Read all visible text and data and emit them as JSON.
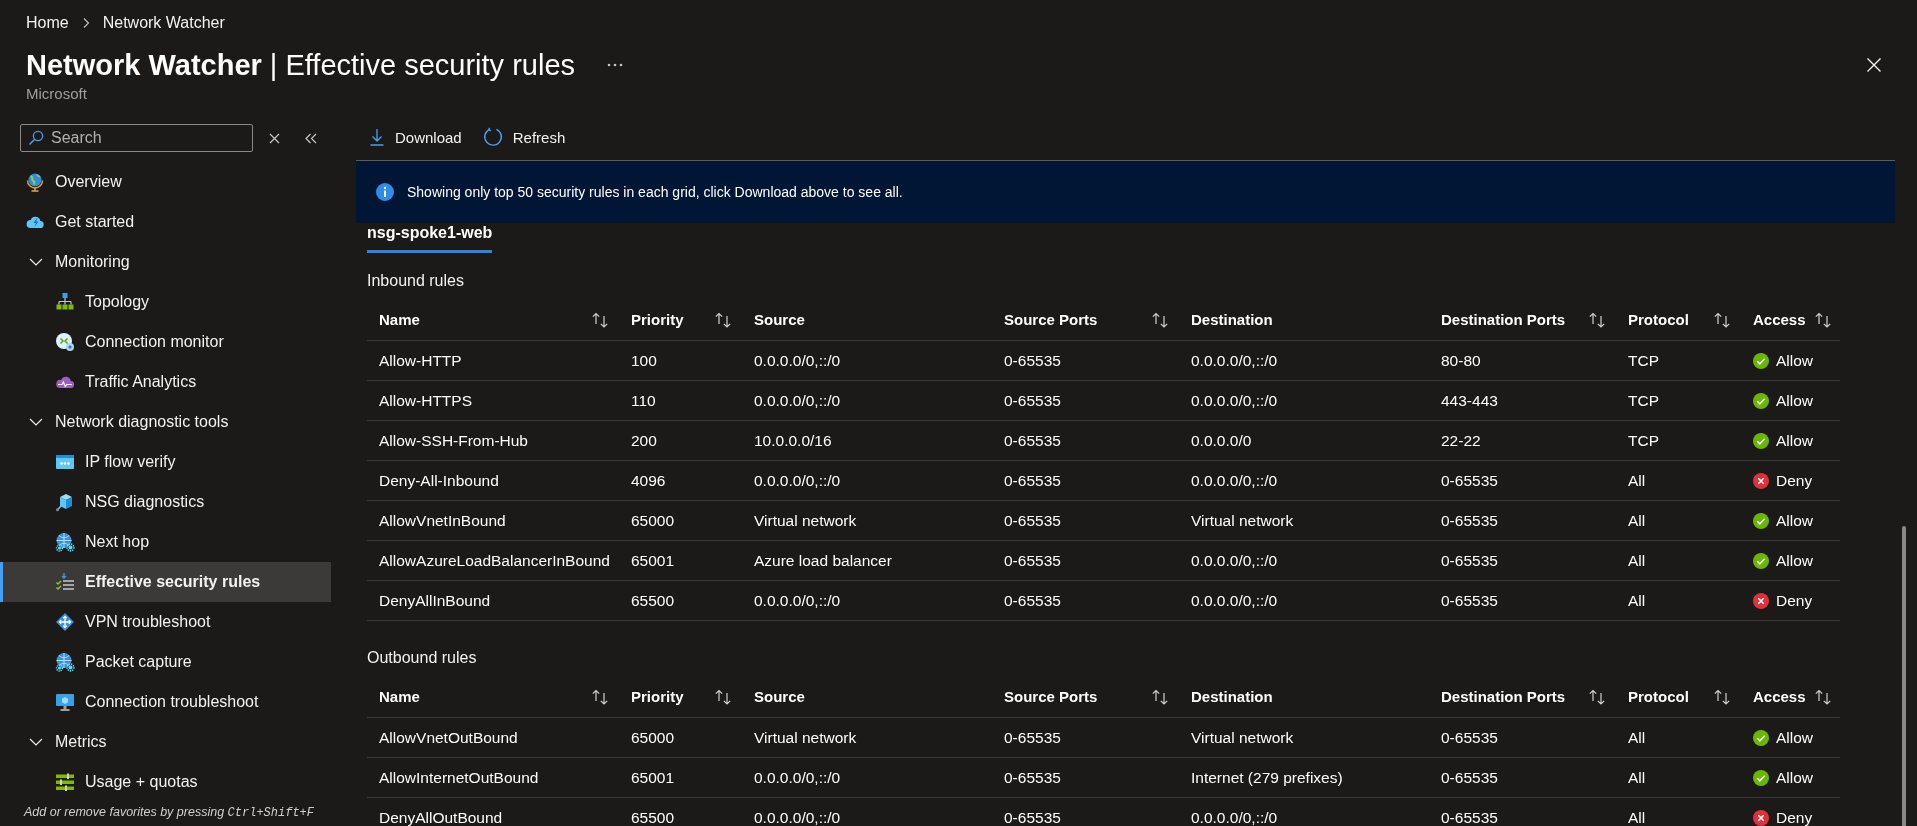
{
  "breadcrumb": [
    {
      "label": "Home"
    },
    {
      "label": "Network Watcher"
    }
  ],
  "header": {
    "title": "**Network Watcher** | Effective security rules",
    "subtitle": "Microsoft"
  },
  "sidebar": {
    "search": {
      "placeholder": "Search"
    },
    "items": [
      {
        "kind": "link",
        "label": "Overview",
        "selected": false
      },
      {
        "kind": "link",
        "label": "Get started",
        "selected": false
      },
      {
        "kind": "group",
        "label": "Monitoring",
        "expanded": true,
        "children": [
          {
            "kind": "link",
            "label": "Topology",
            "selected": false
          },
          {
            "kind": "link",
            "label": "Connection monitor",
            "selected": false
          },
          {
            "kind": "link",
            "label": "Traffic Analytics",
            "selected": false
          }
        ]
      },
      {
        "kind": "group",
        "label": "Network diagnostic tools",
        "expanded": true,
        "children": [
          {
            "kind": "link",
            "label": "IP flow verify",
            "selected": false
          },
          {
            "kind": "link",
            "label": "NSG diagnostics",
            "selected": false
          },
          {
            "kind": "link",
            "label": "Next hop",
            "selected": false
          },
          {
            "kind": "link",
            "label": "Effective security rules",
            "selected": true
          },
          {
            "kind": "link",
            "label": "VPN troubleshoot",
            "selected": false
          },
          {
            "kind": "link",
            "label": "Packet capture",
            "selected": false
          },
          {
            "kind": "link",
            "label": "Connection troubleshoot",
            "selected": false
          }
        ]
      },
      {
        "kind": "group",
        "label": "Metrics",
        "expanded": true,
        "children": [
          {
            "kind": "link",
            "label": "Usage + quotas",
            "selected": false
          }
        ]
      }
    ],
    "favorites_hint": {
      "text": "Add or remove favorites by pressing",
      "shortcut": "Ctrl+Shift+F"
    }
  },
  "toolbar": [
    {
      "label": "Download"
    },
    {
      "label": "Refresh"
    }
  ],
  "banner": {
    "text": "Showing only top 50 security rules in each grid, click Download above to see all."
  },
  "tabs": [
    {
      "label": "nsg-spoke1-web",
      "selected": true
    }
  ],
  "sections": [
    {
      "title": "Inbound rules",
      "columns": [
        {
          "label": "Name",
          "sortable": true
        },
        {
          "label": "Priority",
          "sortable": true
        },
        {
          "label": "Source",
          "sortable": false
        },
        {
          "label": "Source Ports",
          "sortable": true
        },
        {
          "label": "Destination",
          "sortable": false
        },
        {
          "label": "Destination Ports",
          "sortable": true
        },
        {
          "label": "Protocol",
          "sortable": true
        },
        {
          "label": "Access",
          "sortable": true
        }
      ],
      "rows": [
        {
          "cells": [
            "Allow-HTTP",
            "100",
            "0.0.0.0/0,::/0",
            "0-65535",
            "0.0.0.0/0,::/0",
            "80-80",
            "TCP"
          ],
          "access": {
            "kind": "allow",
            "label": "Allow"
          }
        },
        {
          "cells": [
            "Allow-HTTPS",
            "110",
            "0.0.0.0/0,::/0",
            "0-65535",
            "0.0.0.0/0,::/0",
            "443-443",
            "TCP"
          ],
          "access": {
            "kind": "allow",
            "label": "Allow"
          }
        },
        {
          "cells": [
            "Allow-SSH-From-Hub",
            "200",
            "10.0.0.0/16",
            "0-65535",
            "0.0.0.0/0",
            "22-22",
            "TCP"
          ],
          "access": {
            "kind": "allow",
            "label": "Allow"
          }
        },
        {
          "cells": [
            "Deny-All-Inbound",
            "4096",
            "0.0.0.0/0,::/0",
            "0-65535",
            "0.0.0.0/0,::/0",
            "0-65535",
            "All"
          ],
          "access": {
            "kind": "deny",
            "label": "Deny"
          }
        },
        {
          "cells": [
            "AllowVnetInBound",
            "65000",
            "Virtual network",
            "0-65535",
            "Virtual network",
            "0-65535",
            "All"
          ],
          "access": {
            "kind": "allow",
            "label": "Allow"
          }
        },
        {
          "cells": [
            "AllowAzureLoadBalancerInBound",
            "65001",
            "Azure load balancer",
            "0-65535",
            "0.0.0.0/0,::/0",
            "0-65535",
            "All"
          ],
          "access": {
            "kind": "allow",
            "label": "Allow"
          }
        },
        {
          "cells": [
            "DenyAllInBound",
            "65500",
            "0.0.0.0/0,::/0",
            "0-65535",
            "0.0.0.0/0,::/0",
            "0-65535",
            "All"
          ],
          "access": {
            "kind": "deny",
            "label": "Deny"
          }
        }
      ]
    },
    {
      "title": "Outbound rules",
      "columns": [
        {
          "label": "Name",
          "sortable": true
        },
        {
          "label": "Priority",
          "sortable": true
        },
        {
          "label": "Source",
          "sortable": false
        },
        {
          "label": "Source Ports",
          "sortable": true
        },
        {
          "label": "Destination",
          "sortable": false
        },
        {
          "label": "Destination Ports",
          "sortable": true
        },
        {
          "label": "Protocol",
          "sortable": true
        },
        {
          "label": "Access",
          "sortable": true
        }
      ],
      "rows": [
        {
          "cells": [
            "AllowVnetOutBound",
            "65000",
            "Virtual network",
            "0-65535",
            "Virtual network",
            "0-65535",
            "All"
          ],
          "access": {
            "kind": "allow",
            "label": "Allow"
          }
        },
        {
          "cells": [
            "AllowInternetOutBound",
            "65001",
            "0.0.0.0/0,::/0",
            "0-65535",
            "Internet (279 prefixes)",
            "0-65535",
            "All"
          ],
          "access": {
            "kind": "allow",
            "label": "Allow"
          }
        },
        {
          "cells": [
            "DenyAllOutBound",
            "65500",
            "0.0.0.0/0,::/0",
            "0-65535",
            "0.0.0.0/0,::/0",
            "0-65535",
            "All"
          ],
          "access": {
            "kind": "deny",
            "label": "Deny"
          }
        }
      ]
    }
  ]
}
